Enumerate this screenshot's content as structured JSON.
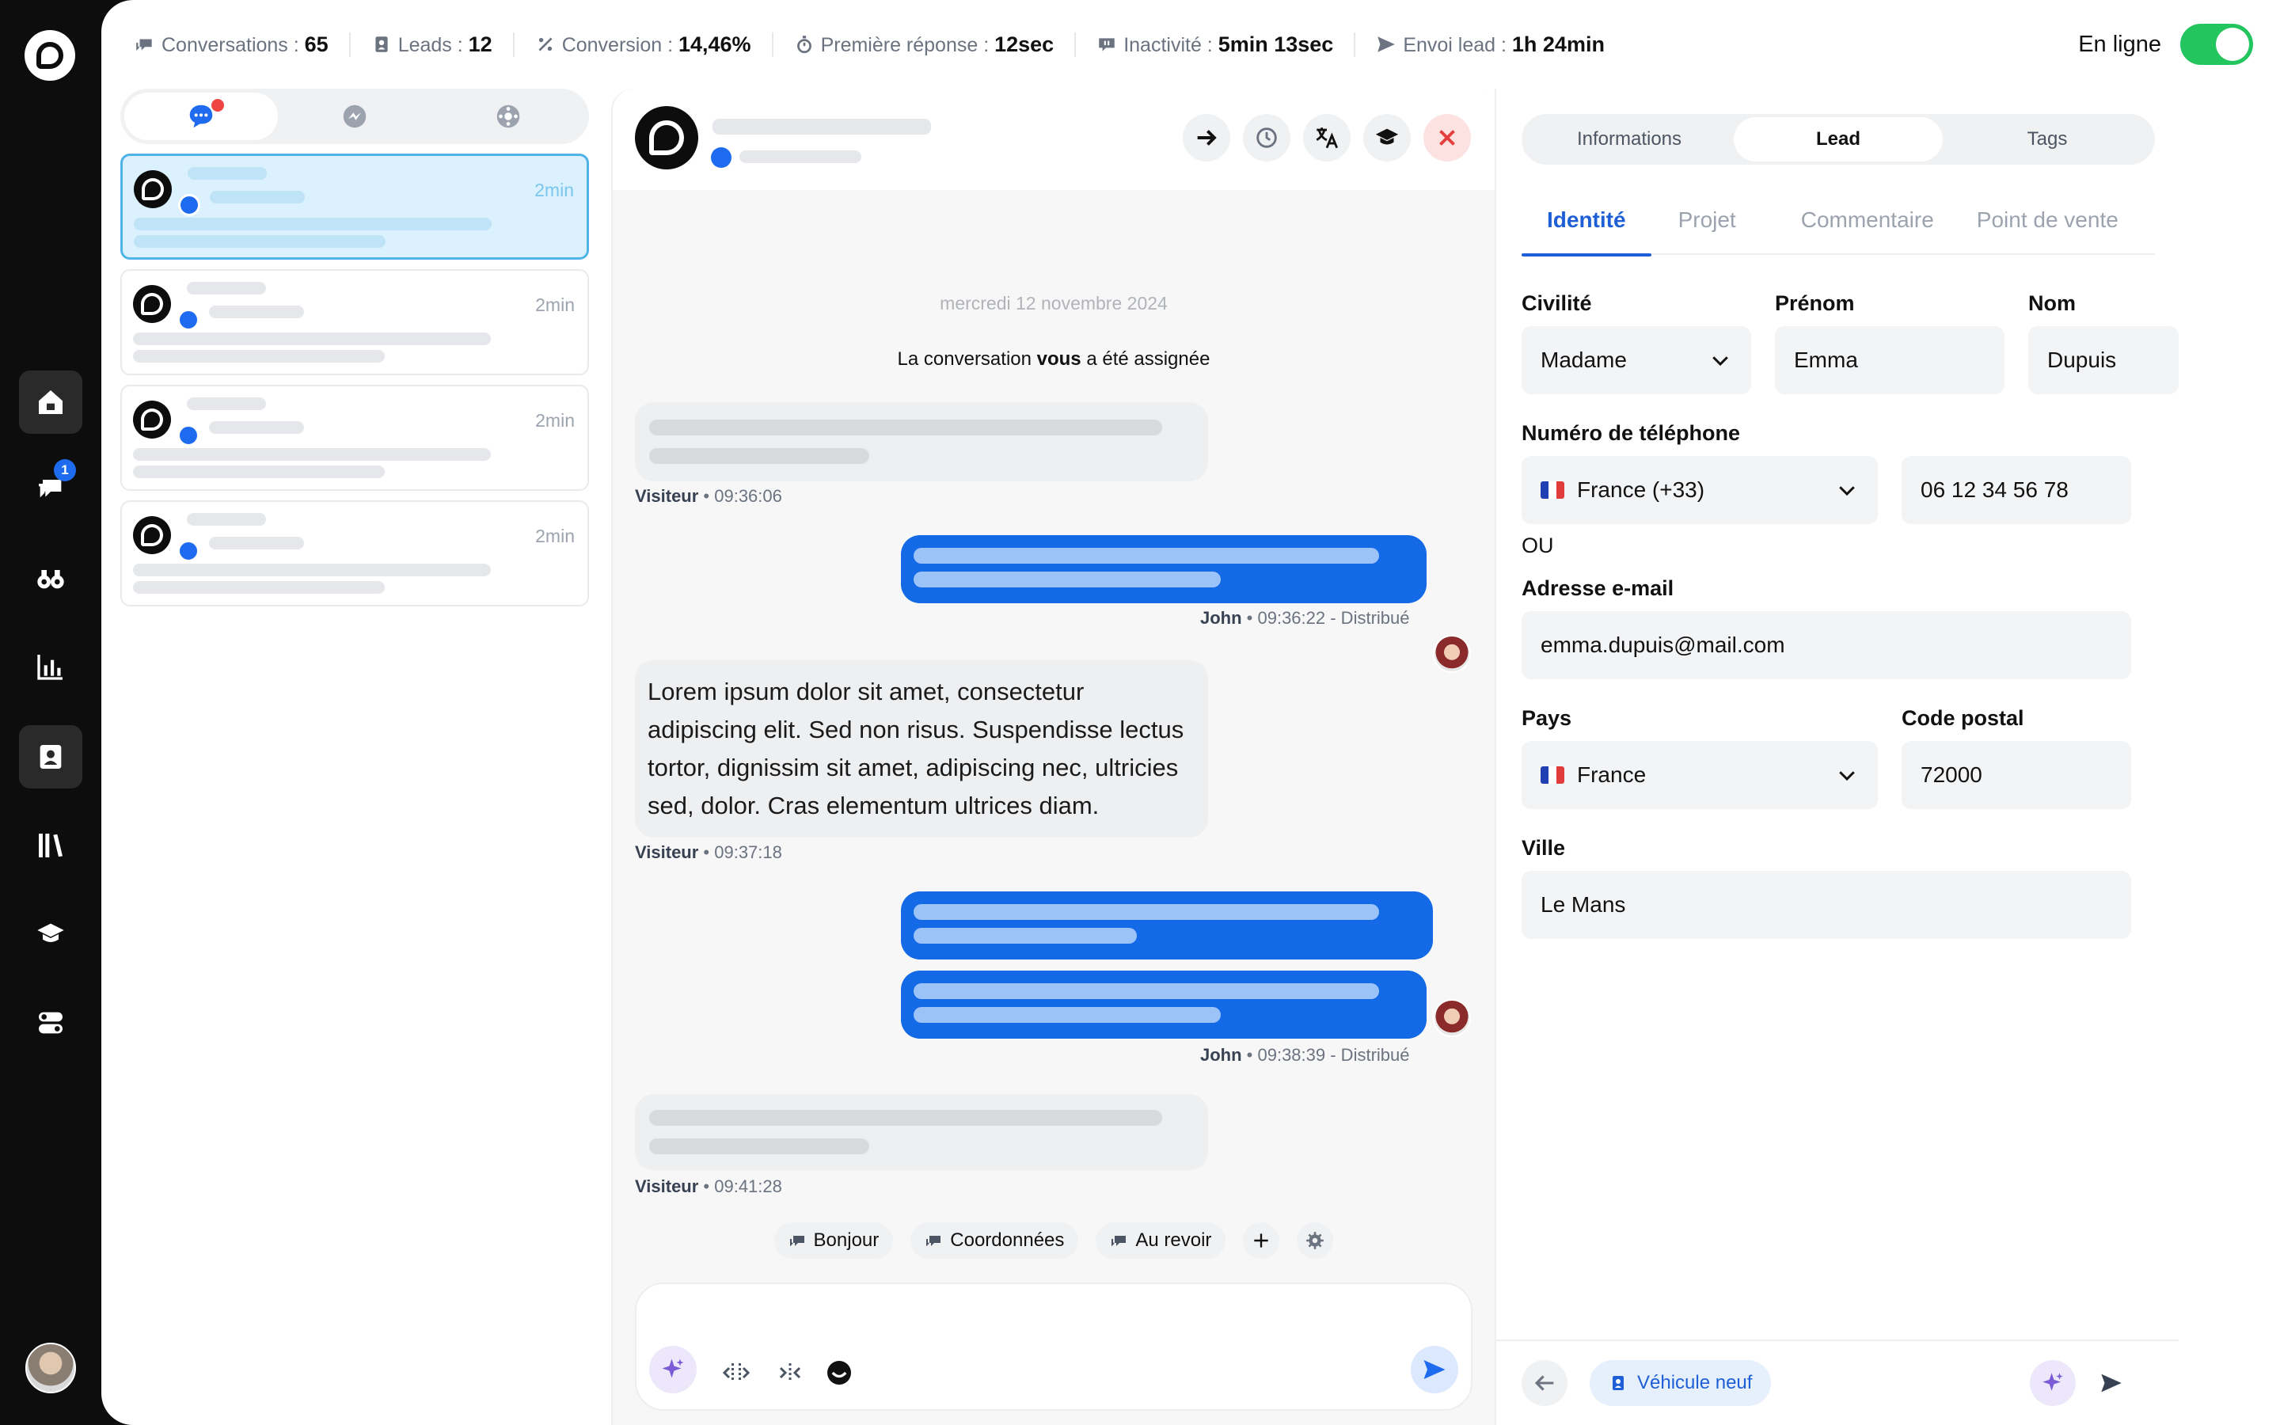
{
  "stats": [
    {
      "label": "Conversations : ",
      "value": "65",
      "icon": "chat-icon"
    },
    {
      "label": "Leads : ",
      "value": "12",
      "icon": "contact-card-icon"
    },
    {
      "label": "Conversion : ",
      "value": "14,46%",
      "icon": "percent-icon"
    },
    {
      "label": "Première réponse : ",
      "value": "12sec",
      "icon": "stopwatch-icon"
    },
    {
      "label": "Inactivité : ",
      "value": "5min 13sec",
      "icon": "chat-pause-icon"
    },
    {
      "label": "Envoi lead : ",
      "value": "1h 24min",
      "icon": "send-icon"
    }
  ],
  "status": {
    "label": "En ligne",
    "online": true,
    "color": "#22c55e"
  },
  "rail": {
    "badge": "1"
  },
  "conversations": [
    {
      "time": "2min",
      "selected": true
    },
    {
      "time": "2min",
      "selected": false
    },
    {
      "time": "2min",
      "selected": false
    },
    {
      "time": "2min",
      "selected": false
    }
  ],
  "chat": {
    "date": "mercredi 12 novembre 2024",
    "assigned_prefix": "La conversation ",
    "assigned_bold": "vous",
    "assigned_suffix": " a été assignée",
    "messages": [
      {
        "who": "Visiteur",
        "time": " • 09:36:06"
      },
      {
        "who": "John",
        "time": " • 09:36:22 - Distribué"
      },
      {
        "who": "Visiteur",
        "time": " • 09:37:18",
        "text": "Lorem ipsum dolor sit amet, consectetur adipiscing elit. Sed non risus. Suspendisse lectus tortor, dignissim sit amet, adipiscing nec, ultricies sed, dolor. Cras elementum ultrices diam."
      },
      {
        "who": "John",
        "time": " • 09:38:39 - Distribué"
      },
      {
        "who": "Visiteur",
        "time": " • 09:41:28"
      }
    ],
    "quick_replies": [
      "Bonjour",
      "Coordonnées",
      "Au revoir"
    ]
  },
  "panel": {
    "segments": [
      "Informations",
      "Lead",
      "Tags"
    ],
    "active_segment": "Lead",
    "subtabs": [
      "Identité",
      "Projet",
      "Commentaire",
      "Point de vente"
    ],
    "active_subtab": "Identité",
    "labels": {
      "civilite": "Civilité",
      "prenom": "Prénom",
      "nom": "Nom",
      "telephone": "Numéro de téléphone",
      "ou": "OU",
      "email": "Adresse e-mail",
      "pays": "Pays",
      "code_postal": "Code postal",
      "ville": "Ville"
    },
    "values": {
      "civilite": "Madame",
      "prenom": "Emma",
      "nom": "Dupuis",
      "indicatif": "France (+33)",
      "telephone": "06 12 34 56 78",
      "email": "emma.dupuis@mail.com",
      "pays": "France",
      "code_postal": "72000",
      "ville": "Le Mans"
    },
    "footer_chip": "Véhicule neuf"
  }
}
